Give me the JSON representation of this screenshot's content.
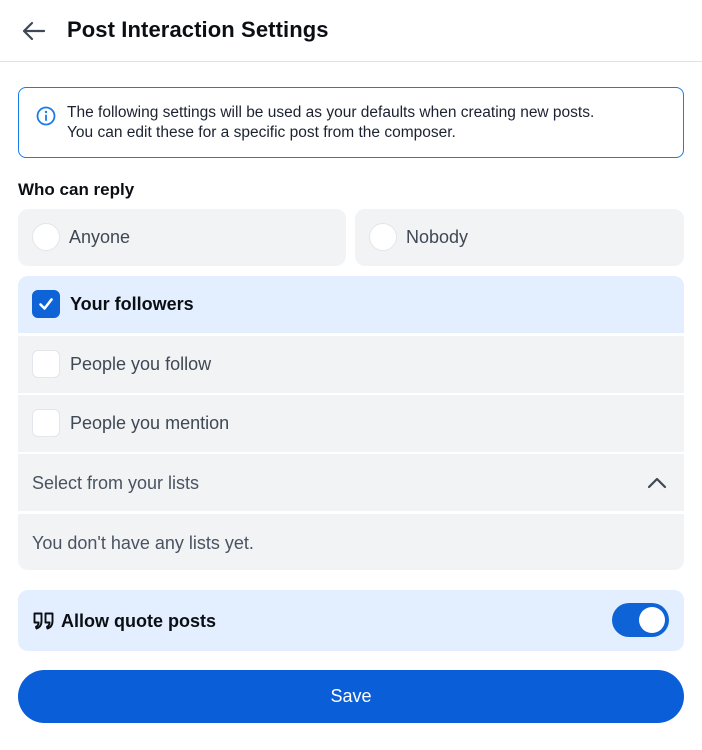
{
  "header": {
    "back_icon": "arrow-left-icon",
    "title": "Post Interaction Settings"
  },
  "info": {
    "icon": "info-circle-icon",
    "line1": "The following settings will be used as your defaults when creating new posts.",
    "line2": "You can edit these for a specific post from the composer."
  },
  "reply": {
    "section_label": "Who can reply",
    "radio_options": [
      {
        "label": "Anyone",
        "selected": false
      },
      {
        "label": "Nobody",
        "selected": false
      }
    ],
    "checkbox_options": [
      {
        "label": "Your followers",
        "checked": true
      },
      {
        "label": "People you follow",
        "checked": false
      },
      {
        "label": "People you mention",
        "checked": false
      }
    ],
    "lists": {
      "label": "Select from your lists",
      "expanded": true,
      "chevron_icon": "chevron-up-icon",
      "empty_text": "You don't have any lists yet."
    }
  },
  "quote": {
    "icon": "quote-icon",
    "label": "Allow quote posts",
    "enabled": true
  },
  "footer": {
    "save_label": "Save"
  },
  "colors": {
    "accent": "#0e63d6",
    "selected_bg": "#e3efff",
    "option_bg": "#f1f3f5",
    "info_border": "#1a7ce8"
  }
}
